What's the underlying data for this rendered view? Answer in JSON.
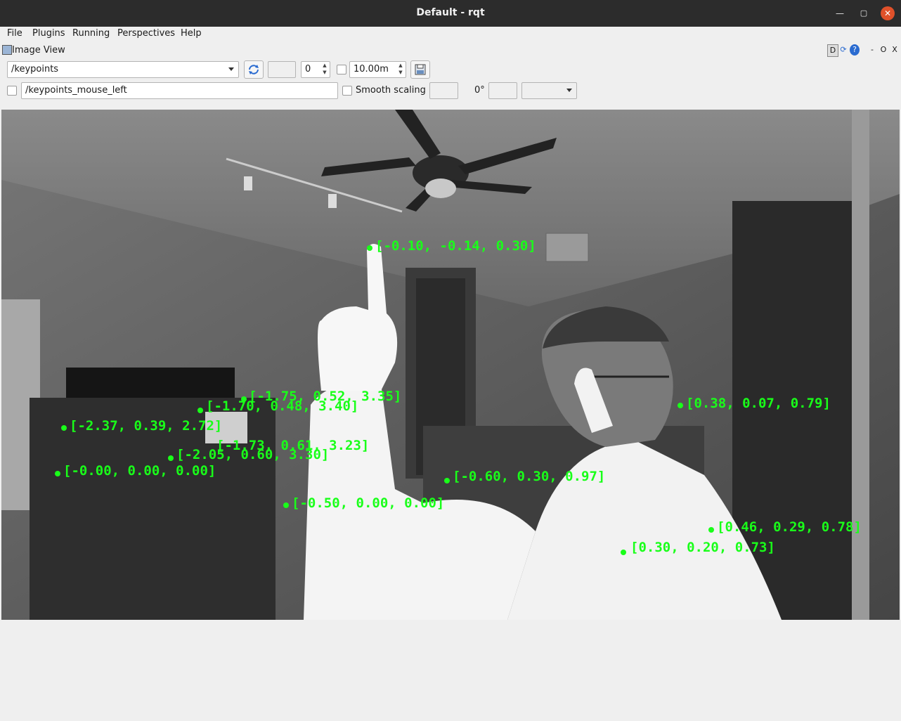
{
  "window": {
    "title": "Default - rqt",
    "min_label": "—",
    "max_label": "▢",
    "close_label": "✕"
  },
  "menu": [
    "File",
    "Plugins",
    "Running",
    "Perspectives",
    "Help"
  ],
  "plugin": {
    "title": "Image View",
    "header_buttons": [
      "D",
      "⟳",
      "?",
      "-",
      "O",
      "X"
    ]
  },
  "toolbar": {
    "topic": "/keypoints",
    "refresh_icon": "refresh-icon",
    "frame_value": "0",
    "period_value": "10.00m",
    "save_icon": "save-icon"
  },
  "row2": {
    "mouse_topic": "/keypoints_mouse_left",
    "smooth_label": "Smooth scaling",
    "rotation_label": "0°"
  },
  "keypoints": [
    "[-0.10, -0.14, 0.30]",
    "[0.38, 0.07, 0.79]",
    "[-2.37, 0.39, 2.72]",
    "[-1.73, 0.61, 3.23]",
    "[-2.05, 0.60, 3.30]",
    "[-0.00, 0.00, 0.00]",
    "[-0.60, 0.30, 0.97]",
    "[-0.50, 0.00, 0.00]",
    "[0.46, 0.29, 0.78]",
    "[0.30, 0.20, 0.73]",
    "[-1.70, 0.48, 3.40]",
    "[-1.75, 0.52, 3.35]"
  ],
  "colors": {
    "keypoint": "#19ff19",
    "titlebar": "#2c2c2c",
    "close": "#e0512a"
  }
}
